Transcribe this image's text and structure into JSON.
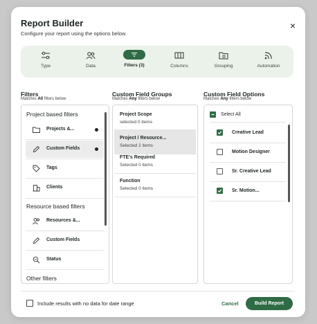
{
  "dialog": {
    "title": "Report Builder",
    "subtitle": "Configure your report using the options below.",
    "close": "×"
  },
  "steps": [
    {
      "label": "Type",
      "icon": "type-sliders-icon"
    },
    {
      "label": "Data",
      "icon": "data-users-icon"
    },
    {
      "label": "Filters (3)",
      "icon": "filter-icon",
      "active": true
    },
    {
      "label": "Columns",
      "icon": "columns-icon"
    },
    {
      "label": "Grouping",
      "icon": "grouping-folder-icon"
    },
    {
      "label": "Automation",
      "icon": "automation-rss-icon"
    }
  ],
  "filters": {
    "title": "Filters",
    "matches_prefix": "Matches",
    "matches_bold": "All",
    "matches_suffix": "filters below",
    "sections": [
      {
        "heading": "Project based filters"
      },
      {
        "heading": "Resource based filters"
      },
      {
        "heading": "Other filters"
      }
    ],
    "items": [
      {
        "label": "Projects &...",
        "icon": "folder-icon",
        "has_dot": true
      },
      {
        "label": "Custom Fields",
        "icon": "pencil-icon",
        "has_dot": true,
        "selected": true
      },
      {
        "label": "Tags",
        "icon": "tag-icon"
      },
      {
        "label": "Clients",
        "icon": "building-icon"
      },
      {
        "label": "Resources &...",
        "icon": "users-icon"
      },
      {
        "label": "Custom Fields",
        "icon": "pencil-icon"
      },
      {
        "label": "Status",
        "icon": "status-search-icon"
      }
    ]
  },
  "groups": {
    "title": "Custom Field Groups",
    "matches_prefix": "Matches",
    "matches_bold": "Any",
    "matches_suffix": "filters below",
    "items": [
      {
        "name": "Project Scope",
        "count": "selected 0 items"
      },
      {
        "name": "Project / Resource...",
        "count": "Selected 2 items",
        "selected": true
      },
      {
        "name": "FTE's Required",
        "count": "Selected 0 items"
      },
      {
        "name": "Function",
        "count": "Selected 0 items"
      }
    ]
  },
  "options": {
    "title": "Custom Field Options",
    "matches_prefix": "Matches",
    "matches_bold": "Any",
    "matches_suffix": "filters below",
    "select_all": "Select All",
    "items": [
      {
        "label": "Creative Lead",
        "checked": true
      },
      {
        "label": "Motion Designer",
        "checked": false
      },
      {
        "label": "Sr. Creative Lead",
        "checked": false
      },
      {
        "label": "Sr. Motion...",
        "checked": true
      }
    ]
  },
  "footer": {
    "include_label": "Include results with no data for date range",
    "cancel": "Cancel",
    "build": "Build Report"
  },
  "colors": {
    "accent": "#2f6b45",
    "steps_bg": "#eaf2ea"
  }
}
